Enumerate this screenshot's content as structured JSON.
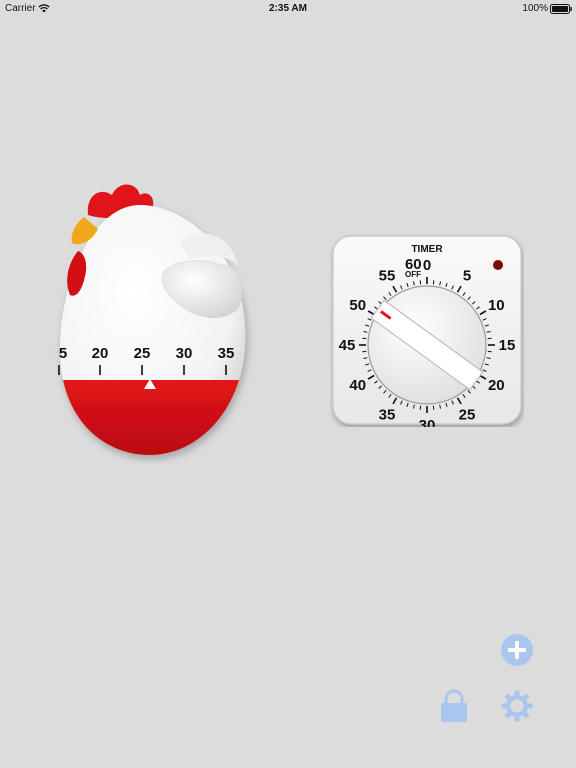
{
  "status_bar": {
    "carrier": "Carrier",
    "time": "2:35 AM",
    "battery": "100%",
    "icons": [
      "wifi-icon",
      "battery-icon"
    ]
  },
  "chicken_timer": {
    "scale_labels": [
      "5",
      "20",
      "25",
      "30",
      "35"
    ]
  },
  "dial_timer": {
    "title": "TIMER",
    "off_label": "OFF",
    "numbers": [
      "0",
      "5",
      "10",
      "15",
      "20",
      "25",
      "30",
      "35",
      "40",
      "45",
      "50",
      "55",
      "60"
    ],
    "knob_position_minutes": 51
  },
  "controls": {
    "icons": [
      "add-icon",
      "lock-icon",
      "gear-icon"
    ],
    "accent_color": "#a9c6ef"
  },
  "colors": {
    "background": "#dcdcdc",
    "chicken_red": "#d40f14",
    "comb_red": "#e0141a",
    "beak_orange": "#f0a81a",
    "indicator_dark_red": "#7a0a0a"
  }
}
